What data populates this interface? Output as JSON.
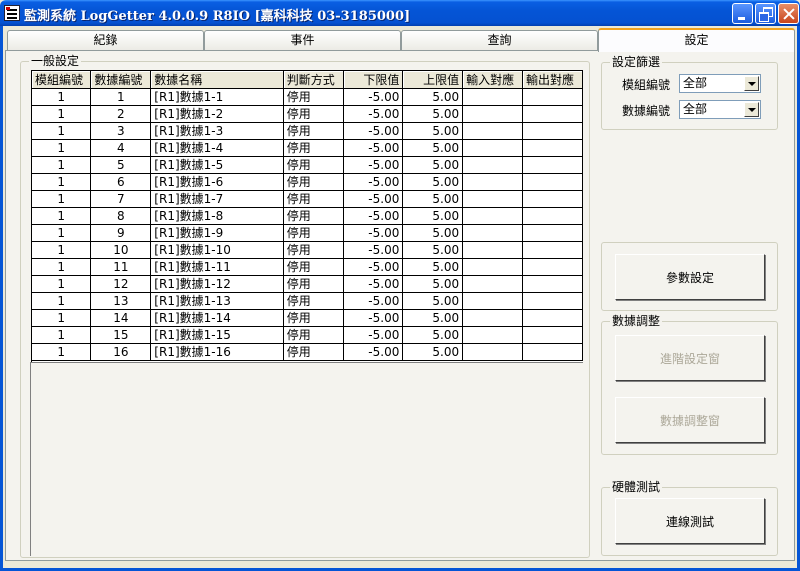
{
  "window": {
    "title": "監測系統 LogGetter 4.0.0.9 R8IO  [嘉科科技 03-3185000]"
  },
  "tabs": [
    {
      "label": "紀錄",
      "active": false
    },
    {
      "label": "事件",
      "active": false
    },
    {
      "label": "查詢",
      "active": false
    },
    {
      "label": "設定",
      "active": true
    }
  ],
  "general": {
    "group_label": "一般設定",
    "columns": [
      "模組編號",
      "數據編號",
      "數據名稱",
      "判斷方式",
      "下限值",
      "上限值",
      "輸入對應",
      "輸出對應"
    ],
    "rows": [
      [
        "1",
        "1",
        "[R1]數據1-1",
        "停用",
        "-5.00",
        "5.00",
        "",
        ""
      ],
      [
        "1",
        "2",
        "[R1]數據1-2",
        "停用",
        "-5.00",
        "5.00",
        "",
        ""
      ],
      [
        "1",
        "3",
        "[R1]數據1-3",
        "停用",
        "-5.00",
        "5.00",
        "",
        ""
      ],
      [
        "1",
        "4",
        "[R1]數據1-4",
        "停用",
        "-5.00",
        "5.00",
        "",
        ""
      ],
      [
        "1",
        "5",
        "[R1]數據1-5",
        "停用",
        "-5.00",
        "5.00",
        "",
        ""
      ],
      [
        "1",
        "6",
        "[R1]數據1-6",
        "停用",
        "-5.00",
        "5.00",
        "",
        ""
      ],
      [
        "1",
        "7",
        "[R1]數據1-7",
        "停用",
        "-5.00",
        "5.00",
        "",
        ""
      ],
      [
        "1",
        "8",
        "[R1]數據1-8",
        "停用",
        "-5.00",
        "5.00",
        "",
        ""
      ],
      [
        "1",
        "9",
        "[R1]數據1-9",
        "停用",
        "-5.00",
        "5.00",
        "",
        ""
      ],
      [
        "1",
        "10",
        "[R1]數據1-10",
        "停用",
        "-5.00",
        "5.00",
        "",
        ""
      ],
      [
        "1",
        "11",
        "[R1]數據1-11",
        "停用",
        "-5.00",
        "5.00",
        "",
        ""
      ],
      [
        "1",
        "12",
        "[R1]數據1-12",
        "停用",
        "-5.00",
        "5.00",
        "",
        ""
      ],
      [
        "1",
        "13",
        "[R1]數據1-13",
        "停用",
        "-5.00",
        "5.00",
        "",
        ""
      ],
      [
        "1",
        "14",
        "[R1]數據1-14",
        "停用",
        "-5.00",
        "5.00",
        "",
        ""
      ],
      [
        "1",
        "15",
        "[R1]數據1-15",
        "停用",
        "-5.00",
        "5.00",
        "",
        ""
      ],
      [
        "1",
        "16",
        "[R1]數據1-16",
        "停用",
        "-5.00",
        "5.00",
        "",
        ""
      ]
    ]
  },
  "filter": {
    "group_label": "設定篩選",
    "module_label": "模組編號",
    "module_value": "全部",
    "data_label": "數據編號",
    "data_value": "全部"
  },
  "params": {
    "button_label": "參數設定"
  },
  "adjust": {
    "group_label": "數據調整",
    "advanced_label": "進階設定窗",
    "adjust_label": "數據調整窗"
  },
  "hardware": {
    "group_label": "硬體測試",
    "test_label": "連線測試"
  },
  "colors": {
    "titlebar": "#0555d6",
    "tab_active_accent": "#f2a21e",
    "window_bg": "#ECE9D8",
    "disabled_text": "#aca899"
  }
}
